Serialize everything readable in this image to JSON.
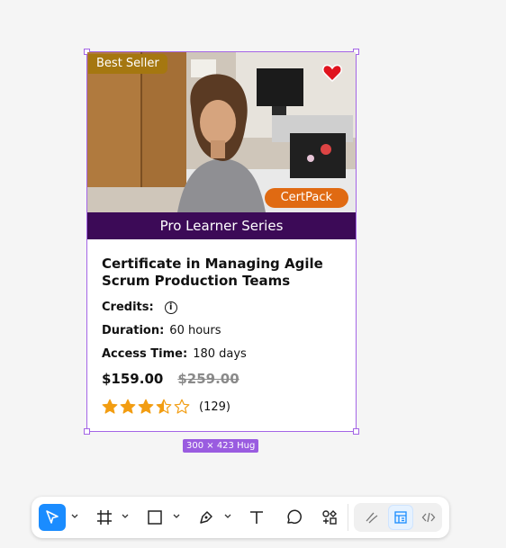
{
  "card": {
    "badge_label": "Best Seller",
    "cert_badge": "CertPack",
    "series": "Pro Learner Series",
    "title": "Certificate in Managing Agile Scrum Production Teams",
    "credits_label": "Credits:",
    "duration_label": "Duration:",
    "duration_value": "60 hours",
    "access_label": "Access Time:",
    "access_value": "180 days",
    "price": "$159.00",
    "old_price": "$259.00",
    "rating": 3.5,
    "rating_max": 5,
    "review_count": "(129)",
    "colors": {
      "badge": "#a57710",
      "cert": "#e06a12",
      "series_bar": "#3c0a57",
      "star": "#f29d12",
      "heart": "#e0141e"
    }
  },
  "canvas": {
    "size_label": "300 × 423 Hug",
    "selection_color": "#a465e6"
  },
  "toolbar": {
    "tools": [
      "move-icon",
      "frame-icon",
      "rectangle-icon",
      "pen-icon",
      "text-icon",
      "comment-icon",
      "actions-icon"
    ],
    "modes": [
      "draw-mode-icon",
      "design-mode-icon",
      "dev-mode-icon"
    ],
    "active_color": "#1a8cff"
  }
}
